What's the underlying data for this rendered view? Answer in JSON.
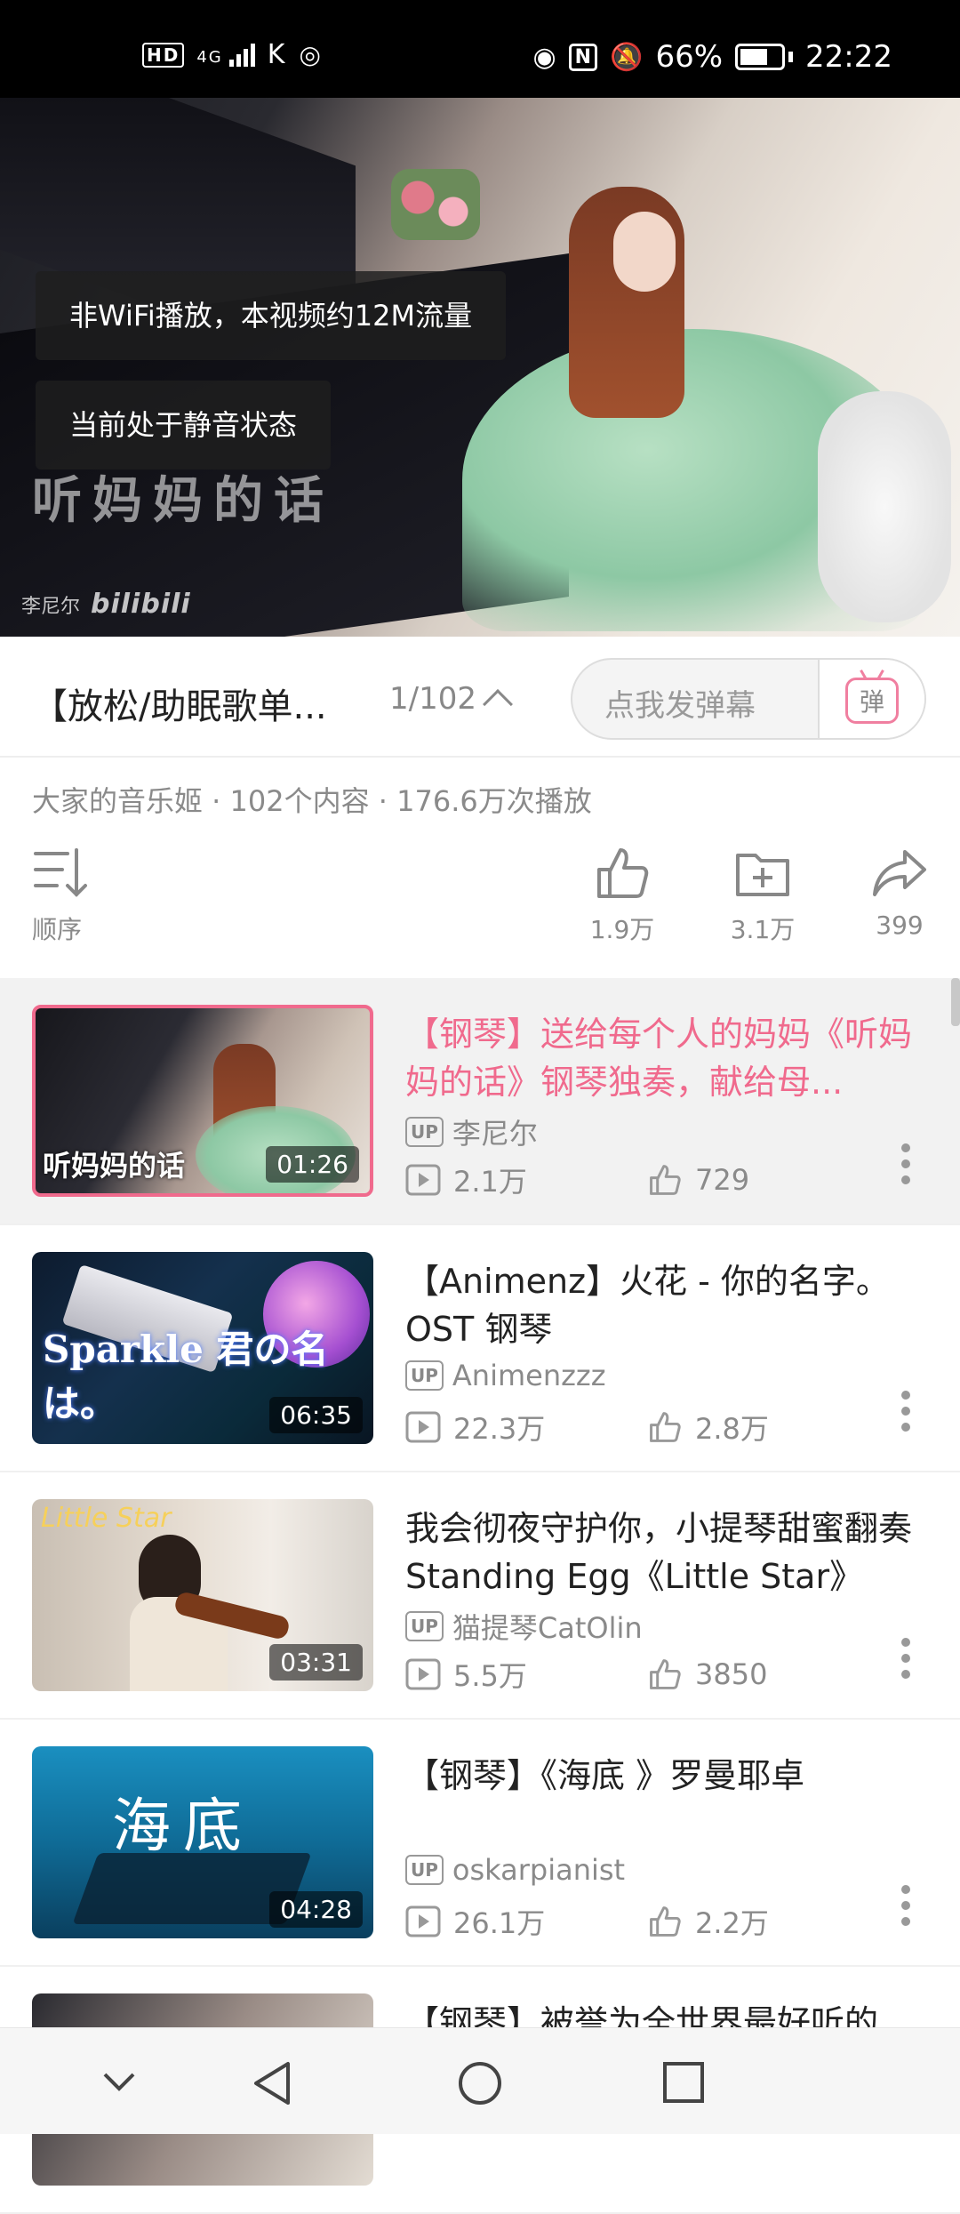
{
  "status": {
    "left_icons": [
      "HD",
      "4G",
      "K",
      "@"
    ],
    "signal_label": "4G",
    "hd_label": "HD",
    "battery": "66%",
    "time": "22:22"
  },
  "player": {
    "toast_data": "非WiFi播放，本视频约12M流量",
    "toast_mute": "当前处于静音状态",
    "watermark_title": "听妈妈的话",
    "watermark_author": "李尼尔",
    "watermark_brand": "bilibili"
  },
  "titlebar": {
    "playlist_title": "【放松/助眠歌单...",
    "playlist_count": "1/102",
    "danmu_placeholder": "点我发弹幕",
    "danmu_icon_text": "弹"
  },
  "info": {
    "text": "大家的音乐姬 · 102个内容 · 176.6万次播放"
  },
  "actions": {
    "sort_label": "顺序",
    "like_count": "1.9万",
    "fav_count": "3.1万",
    "share_count": "399"
  },
  "videos": [
    {
      "title": "【钢琴】送给每个人的妈妈《听妈妈的话》钢琴独奏，献给母...",
      "up": "李尼尔",
      "views": "2.1万",
      "likes": "729",
      "duration": "01:26",
      "thumb_text": "听妈妈的话"
    },
    {
      "title": "【Animenz】火花 - 你的名字。OST 钢琴",
      "up": "Animenzzz",
      "views": "22.3万",
      "likes": "2.8万",
      "duration": "06:35",
      "thumb_text": "Sparkle 君の名は。"
    },
    {
      "title": "我会彻夜守护你，小提琴甜蜜翻奏Standing Egg《Little Star》",
      "up": "猫提琴CatOlin",
      "views": "5.5万",
      "likes": "3850",
      "duration": "03:31",
      "thumb_text": "Little Star"
    },
    {
      "title": "【钢琴】《海底 》罗曼耶卓",
      "up": "oskarpianist",
      "views": "26.1万",
      "likes": "2.2万",
      "duration": "04:28",
      "thumb_text": "海底"
    },
    {
      "title": "【钢琴】被誉为全世界最好听的",
      "up": "",
      "views": "",
      "likes": "",
      "duration": "",
      "thumb_text": ""
    }
  ],
  "badges": {
    "up": "UP"
  }
}
